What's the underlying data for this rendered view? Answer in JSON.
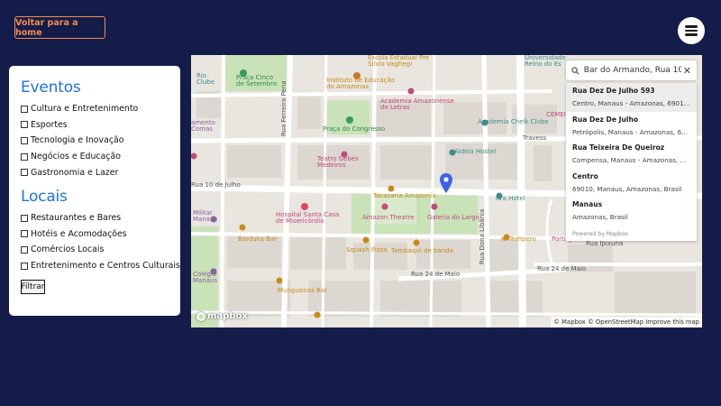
{
  "header": {
    "home_button": "Voltar para a home",
    "menu_icon": "hamburger-menu-icon"
  },
  "filters": {
    "events_title": "Eventos",
    "events": [
      "Cultura e Entretenimento",
      "Esportes",
      "Tecnologia e Inovação",
      "Negócios e Educação",
      "Gastronomia e Lazer"
    ],
    "places_title": "Locais",
    "places": [
      "Restaurantes e Bares",
      "Hotéis e Acomodações",
      "Comércios Locais",
      "Entretenimento e Centros Culturais"
    ],
    "filter_button": "Filtrar"
  },
  "map": {
    "search": {
      "value": "Bar do Armando, Rua 10",
      "icon": "search-icon",
      "clear_icon": "close-icon"
    },
    "results": [
      {
        "title": "Rua Dez De Julho 593",
        "subtitle": "Centro, Manaus - Amazonas, 6901..."
      },
      {
        "title": "Rua Dez De Julho",
        "subtitle": "Petrópolis, Manaus - Amazonas, 6..."
      },
      {
        "title": "Rua Teixeira De Queiroz",
        "subtitle": "Compensa, Manaus - Amazonas, ..."
      },
      {
        "title": "Centro",
        "subtitle": "69010, Manaus, Amazonas, Brasil"
      },
      {
        "title": "Manaus",
        "subtitle": "Amazonas, Brasil"
      }
    ],
    "powered_by": "Powered by Mapbox",
    "logo_text": "mapbox",
    "attribution": "© Mapbox © OpenStreetMap Improve this map",
    "labels": {
      "rua_10_julho": "Rua 10 de Julho",
      "rua_24_maio": "Rua 24 de Maio",
      "rua_24_maio_2": "Rua 24 de Maio",
      "rua_ipixuna": "Rua Ipixuna",
      "rua_ferreira_pena": "Rua Ferreira Pena",
      "rua_dona_libania": "Rua Dona Libânia",
      "travessa": "Travess",
      "praca_cinco": "Praça Cinco\nde Setembro",
      "instituto": "Instituto de Educação\ndo Amazonas",
      "escola": "Escola Estadual Pre\nSilvio Vaghegi",
      "academia_amazonense": "Academia Amazonense\nde Letras",
      "academia_cheik": "Academia Cheik Clube",
      "praca_congresso": "Praça do Congresso",
      "teatro_gebes": "Teatro Gebes\nMedeiros",
      "aldeia_hostel": "Aldeia Hostel",
      "tacacaria": "Tacacaria Amazonia",
      "ara_hotel": "Ara Hotel",
      "hospital": "Hospital Santa Casa\nde Misericórdia",
      "amazon_theatre": "Amazon Theatre",
      "galeria_largo": "Galeria do Largo",
      "barduka": "Barduka Bar",
      "squash_pizza": "Squash Pizza",
      "tambaqui": "Tambaqui de banda",
      "ki_tempero": "Ki Tempero",
      "mungueiras": "Mungueiras Bar",
      "universidade": "Universidade\nReino do Es",
      "cemei": "CEMEI",
      "uxpark": "Portuguesa",
      "rio_clube": "Rio\nClube",
      "amento": "amento\nComas",
      "militar": "Militar\nManaus",
      "colegio": "Colégio\nManaus"
    }
  }
}
